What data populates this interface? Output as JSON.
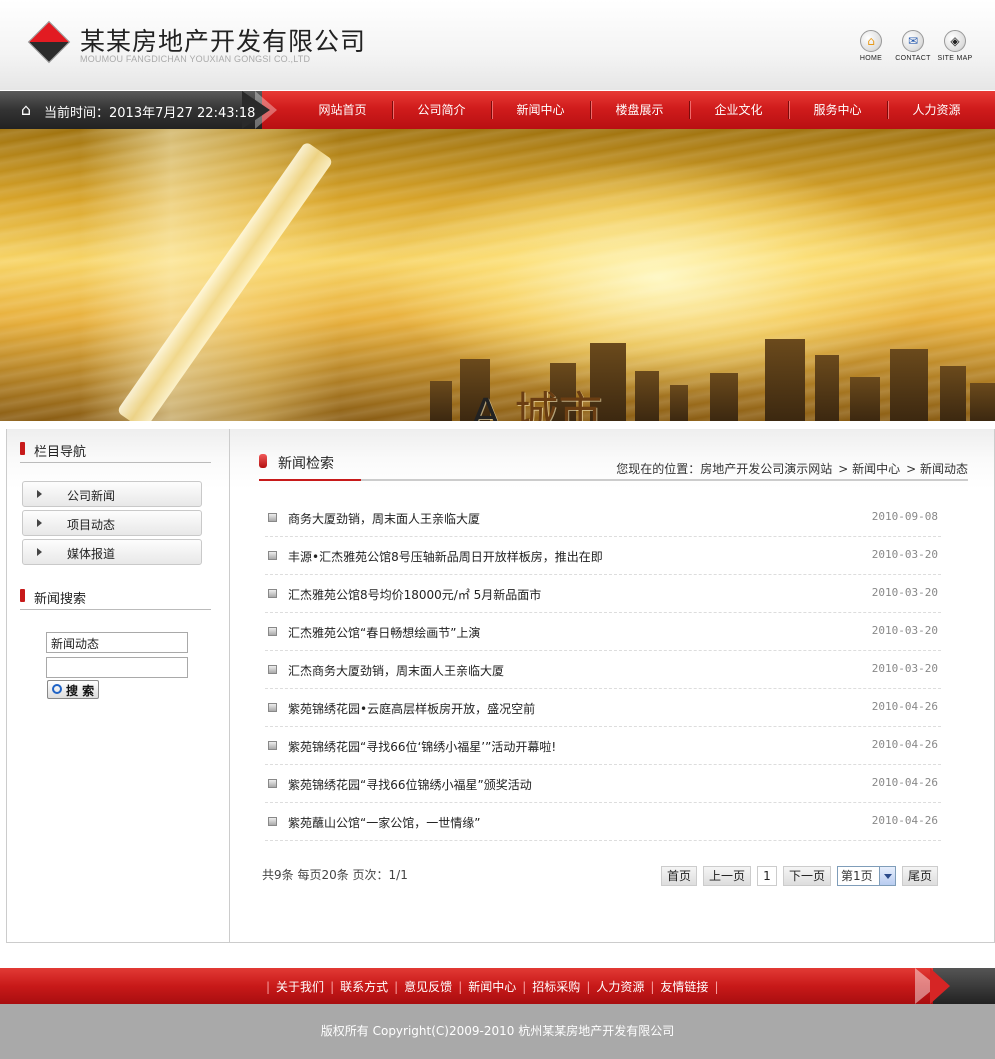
{
  "header": {
    "company_name": "某某房地产开发有限公司",
    "company_sub": "MOUMOU FANGDICHAN YOUXIAN GONGSI CO.,LTD",
    "quick_links": [
      {
        "label": "HOME",
        "icon": "home-icon"
      },
      {
        "label": "CONTACT",
        "icon": "mail-icon"
      },
      {
        "label": "SITE MAP",
        "icon": "sitemap-icon"
      }
    ]
  },
  "nav": {
    "time_text": "当前时间：2013年7月27 22:43:18",
    "items": [
      "网站首页",
      "公司简介",
      "新闻中心",
      "楼盘展示",
      "企业文化",
      "服务中心",
      "人力资源"
    ]
  },
  "banner": {
    "letter": "A",
    "title": "城市"
  },
  "sidebar": {
    "nav_title": "栏目导航",
    "menu": [
      "公司新闻",
      "项目动态",
      "媒体报道"
    ],
    "search_title": "新闻搜索",
    "search_select": "新闻动态",
    "search_button": "搜 索"
  },
  "main": {
    "section_title": "新闻检索",
    "breadcrumb": [
      "您现在的位置：房地产开发公司演示网站",
      "> 新闻中心",
      "> 新闻动态"
    ],
    "news": [
      {
        "title": "商务大厦劲销，周末面人王亲临大厦",
        "date": "2010-09-08"
      },
      {
        "title": "丰源•汇杰雅苑公馆8号压轴新品周日开放样板房，推出在即",
        "date": "2010-03-20"
      },
      {
        "title": "汇杰雅苑公馆8号均价18000元/㎡ 5月新品面市",
        "date": "2010-03-20"
      },
      {
        "title": "汇杰雅苑公馆“春日畅想绘画节”上演",
        "date": "2010-03-20"
      },
      {
        "title": "汇杰商务大厦劲销，周末面人王亲临大厦",
        "date": "2010-03-20"
      },
      {
        "title": "紫苑锦绣花园•云庭高层样板房开放，盛况空前",
        "date": "2010-04-26"
      },
      {
        "title": "紫苑锦绣花园“寻找66位‘锦绣小福星’”活动开幕啦!",
        "date": "2010-04-26"
      },
      {
        "title": "紫苑锦绣花园“寻找66位锦绣小福星”颁奖活动",
        "date": "2010-04-26"
      },
      {
        "title": "紫苑蘸山公馆“一家公馆，一世情缘”",
        "date": "2010-04-26"
      }
    ],
    "pager": {
      "info": "共9条  每页20条  页次：1/1",
      "first": "首页",
      "prev": "上一页",
      "current": "1",
      "next": "下一页",
      "select": "第1页",
      "last": "尾页"
    }
  },
  "footer": {
    "links": [
      "关于我们",
      "联系方式",
      "意见反馈",
      "新闻中心",
      "招标采购",
      "人力资源",
      "友情链接"
    ],
    "copyright": "版权所有  Copyright(C)2009-2010 杭州某某房地产开发有限公司"
  },
  "colors": {
    "accent_red": "#c71a1a",
    "dark_gray": "#333333",
    "footer_gray": "#a9a9a9"
  }
}
